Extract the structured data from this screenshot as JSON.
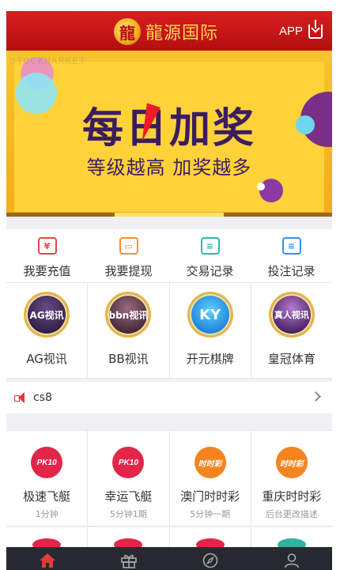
{
  "header": {
    "logo_mark": "龍",
    "logo_text": "龍源国际",
    "app_label": "APP",
    "colors": {
      "bar": "#c8161a",
      "logo": "#ffd552"
    }
  },
  "banner": {
    "watermark": "STOCKMARKET",
    "title": "每日加奖",
    "subtitle": "等级越高 加奖越多",
    "slide_active": 2,
    "slide_count": 3
  },
  "quick_actions": [
    {
      "label": "我要充值",
      "icon": "recharge-icon",
      "color": "#e54646"
    },
    {
      "label": "我要提现",
      "icon": "wallet-icon",
      "color": "#f09030"
    },
    {
      "label": "交易记录",
      "icon": "transaction-record-icon",
      "color": "#2fb8a8"
    },
    {
      "label": "投注记录",
      "icon": "betting-record-icon",
      "color": "#3a8ee6"
    }
  ],
  "games": [
    {
      "label": "AG视讯",
      "icon": "ag-live-icon",
      "badge": "AG视讯"
    },
    {
      "label": "BB视讯",
      "icon": "bb-live-icon",
      "badge": "bbn视讯"
    },
    {
      "label": "开元棋牌",
      "icon": "ky-chess-icon",
      "badge": "KY"
    },
    {
      "label": "皇冠体育",
      "icon": "crown-sports-icon",
      "badge": "真人视讯"
    }
  ],
  "notice": {
    "text": "cs8"
  },
  "lotteries": [
    {
      "name": "极速飞艇",
      "desc": "1分钟",
      "badge": "PK10",
      "color": "#e4254a"
    },
    {
      "name": "幸运飞艇",
      "desc": "5分钟1期",
      "badge": "PK10",
      "color": "#e4254a"
    },
    {
      "name": "澳门时时彩",
      "desc": "5分钟一期",
      "badge": "时时彩",
      "color": "#f5841f"
    },
    {
      "name": "重庆时时彩",
      "desc": "后台更改描述",
      "badge": "时时彩",
      "color": "#f5841f"
    }
  ],
  "lotteries_row2_colors": [
    "#e4254a",
    "#e4254a",
    "#e4254a",
    "#2fb39a"
  ],
  "tabbar": [
    {
      "icon": "home-icon",
      "active": true
    },
    {
      "icon": "gift-icon",
      "active": false
    },
    {
      "icon": "compass-icon",
      "active": false
    },
    {
      "icon": "user-icon",
      "active": false
    }
  ]
}
